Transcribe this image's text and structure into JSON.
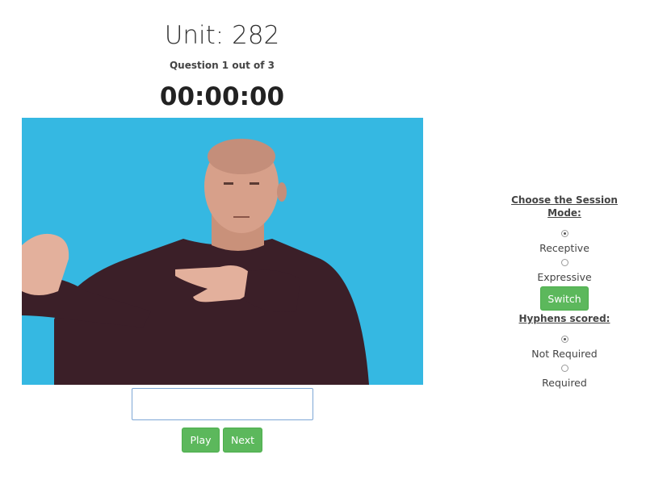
{
  "header": {
    "unit_title": "Unit: 282",
    "question_progress": "Question 1 out of 3",
    "timer": "00:00:00"
  },
  "video": {
    "background_color": "#35b8e2"
  },
  "answer": {
    "value": "",
    "placeholder": ""
  },
  "controls": {
    "play_label": "Play",
    "next_label": "Next",
    "button_color": "#5cb85c"
  },
  "session_mode": {
    "heading": "Choose the Session Mode:",
    "options": [
      {
        "label": "Receptive",
        "checked": true
      },
      {
        "label": "Expressive",
        "checked": false
      }
    ],
    "switch_label": "Switch"
  },
  "hyphens": {
    "heading": "Hyphens scored:",
    "options": [
      {
        "label": "Not Required",
        "checked": true
      },
      {
        "label": "Required",
        "checked": false
      }
    ]
  }
}
